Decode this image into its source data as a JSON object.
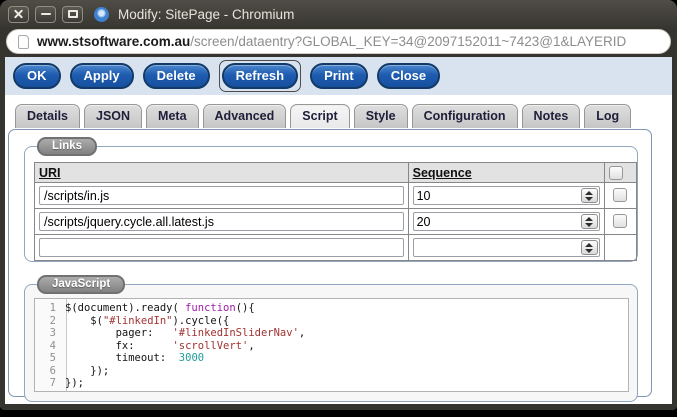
{
  "window": {
    "title": "Modify: SitePage - Chromium",
    "controls": [
      {
        "name": "close"
      },
      {
        "name": "minimize"
      },
      {
        "name": "maximize"
      }
    ]
  },
  "address_bar": {
    "domain": "www.stsoftware.com.au",
    "path": "/screen/dataentry?GLOBAL_KEY=34@2097152011~7423@1&LAYERID"
  },
  "toolbar": {
    "buttons": [
      "OK",
      "Apply",
      "Delete",
      "Refresh",
      "Print",
      "Close"
    ],
    "focused_button": "Refresh"
  },
  "tabs": {
    "active": "Script",
    "items": [
      "Details",
      "JSON",
      "Meta",
      "Advanced",
      "Script",
      "Style",
      "Configuration",
      "Notes",
      "Log"
    ]
  },
  "links_section": {
    "legend": "Links",
    "columns": {
      "uri": "URI",
      "sequence": "Sequence"
    },
    "rows": [
      {
        "uri": "/scripts/in.js",
        "sequence": "10",
        "checkbox": true
      },
      {
        "uri": "/scripts/jquery.cycle.all.latest.js",
        "sequence": "20",
        "checkbox": true
      },
      {
        "uri": "",
        "sequence": "",
        "checkbox": false
      }
    ]
  },
  "javascript_section": {
    "legend": "JavaScript",
    "lines": [
      {
        "num": "1",
        "segments": [
          {
            "t": "$(document).ready( ",
            "c": "p"
          },
          {
            "t": "function",
            "c": "k"
          },
          {
            "t": "(){",
            "c": "p"
          }
        ]
      },
      {
        "num": "2",
        "segments": [
          {
            "t": "    $(",
            "c": "p"
          },
          {
            "t": "\"#linkedIn\"",
            "c": "s"
          },
          {
            "t": ").cycle({",
            "c": "p"
          }
        ]
      },
      {
        "num": "3",
        "segments": [
          {
            "t": "        pager:   ",
            "c": "p"
          },
          {
            "t": "'#linkedInSliderNav'",
            "c": "s"
          },
          {
            "t": ",",
            "c": "p"
          }
        ]
      },
      {
        "num": "4",
        "segments": [
          {
            "t": "        fx:      ",
            "c": "p"
          },
          {
            "t": "'scrollVert'",
            "c": "s"
          },
          {
            "t": ",",
            "c": "p"
          }
        ]
      },
      {
        "num": "5",
        "segments": [
          {
            "t": "        timeout:  ",
            "c": "p"
          },
          {
            "t": "3000",
            "c": "n"
          }
        ]
      },
      {
        "num": "6",
        "segments": [
          {
            "t": "    });",
            "c": "p"
          }
        ]
      },
      {
        "num": "7",
        "segments": [
          {
            "t": "});",
            "c": "p"
          }
        ]
      }
    ]
  },
  "colors": {
    "titlebar": "#464440",
    "toolbar_bg": "#d8e3ef",
    "button_blue": "#1e5cb0",
    "panel_border": "#7d97b5",
    "legend_gray": "#8a8a8a",
    "tab_text": "#1e1e3a",
    "syntax_keyword": "#a020a8",
    "syntax_string": "#a03232",
    "syntax_number": "#1f9c9c"
  }
}
